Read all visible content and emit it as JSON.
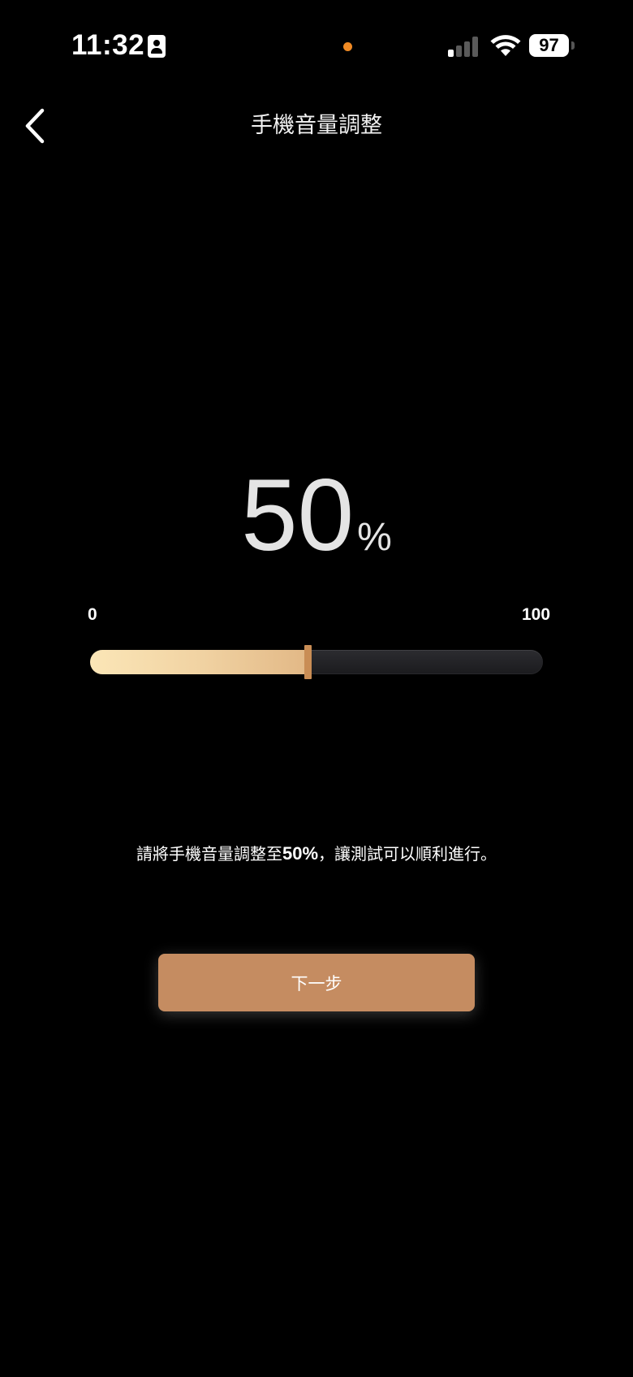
{
  "status_bar": {
    "time": "11:32",
    "battery": "97",
    "icons": [
      "id-card-icon",
      "privacy-dot",
      "cellular-signal-icon",
      "wifi-icon",
      "battery-icon"
    ],
    "privacy_dot_color": "#f08a24"
  },
  "nav": {
    "back_icon": "chevron-left-icon",
    "title": "手機音量調整"
  },
  "volume": {
    "value": "50",
    "unit": "%",
    "scale_min": "0",
    "scale_max": "100",
    "level": 0.48
  },
  "instruction": {
    "before": "請將手機音量調整至",
    "highlight": "50%",
    "after": "，讓測試可以順利進行。"
  },
  "next_button": {
    "label": "下一步"
  },
  "colors": {
    "background": "#000000",
    "accent": "#c58c61",
    "slider_thumb": "#c98d55",
    "slider_fill_start": "#fbe6b7",
    "slider_fill_end": "#e2b886"
  }
}
